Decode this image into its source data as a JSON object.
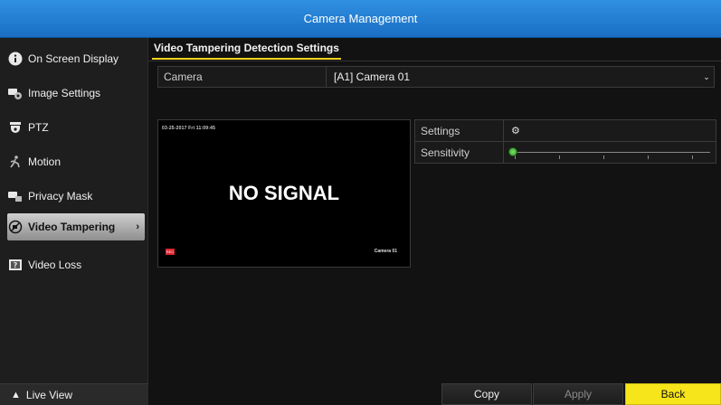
{
  "window": {
    "title": "Camera Management"
  },
  "sidebar": {
    "items": [
      {
        "label": "On Screen Display",
        "icon": "info-icon"
      },
      {
        "label": "Image Settings",
        "icon": "image-settings-icon"
      },
      {
        "label": "PTZ",
        "icon": "ptz-dome-icon"
      },
      {
        "label": "Motion",
        "icon": "motion-icon"
      },
      {
        "label": "Privacy Mask",
        "icon": "privacy-mask-icon"
      },
      {
        "label": "Video Tampering",
        "icon": "video-tampering-icon",
        "active": true
      },
      {
        "label": "Video Loss",
        "icon": "video-loss-icon"
      }
    ],
    "live_view": "Live View"
  },
  "main": {
    "tab": "Video Tampering Detection Settings",
    "camera": {
      "label": "Camera",
      "value": "[A1] Camera 01"
    },
    "preview": {
      "timestamp": "03-25-2017 Fri 11:09:45",
      "no_signal": "NO SIGNAL",
      "rec_badge": "REC",
      "camera_name": "Camera 01"
    },
    "settings": {
      "label": "Settings"
    },
    "sensitivity": {
      "label": "Sensitivity",
      "value_fraction": 0.0
    }
  },
  "footer": {
    "copy": "Copy",
    "apply": "Apply",
    "back": "Back"
  },
  "colors": {
    "title_bar": "#1f7ed6",
    "accent_yellow": "#f5e51a",
    "active_item": "#bdbdbd"
  }
}
